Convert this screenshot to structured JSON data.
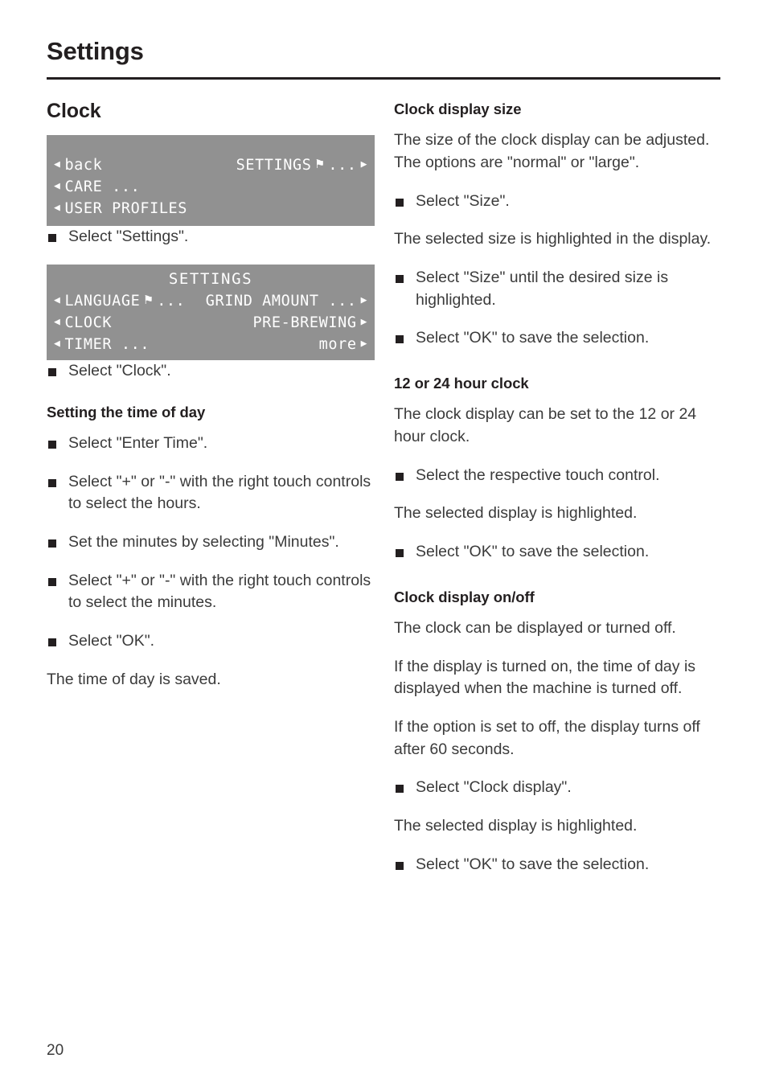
{
  "header": {
    "title": "Settings",
    "page_number": "20"
  },
  "left_column": {
    "section_title": "Clock",
    "display_1": {
      "rows": [
        {
          "left_caret": "◀",
          "left_text": "back",
          "right_text": "SETTINGS",
          "right_flag": "⚑",
          "right_ellipsis": "...",
          "right_caret": "▶"
        },
        {
          "left_caret": "◀",
          "left_text": "CARE ...",
          "right_text": "",
          "right_caret": ""
        },
        {
          "left_caret": "◀",
          "left_text": "USER PROFILES",
          "right_text": "",
          "right_caret": ""
        }
      ]
    },
    "step_after_display_1": "Select \"Settings\".",
    "display_2": {
      "title": "SETTINGS",
      "rows": [
        {
          "left_caret": "◀",
          "left_text": "LANGUAGE",
          "left_flag": "⚑",
          "left_ellipsis": "...",
          "right_text": "GRIND AMOUNT ...",
          "right_caret": "▶"
        },
        {
          "left_caret": "◀",
          "left_text": "CLOCK",
          "right_text": "PRE-BREWING",
          "right_caret": "▶"
        },
        {
          "left_caret": "◀",
          "left_text": "TIMER ...",
          "right_text": "more",
          "right_caret": "▶"
        }
      ]
    },
    "step_after_display_2": "Select \"Clock\".",
    "sub_title": "Setting the time of day",
    "steps": [
      "Select \"Enter Time\".",
      "Select \"+\" or \"-\" with the right touch controls to select the hours.",
      "Set the minutes by selecting \"Minutes\".",
      "Select \"+\" or \"-\" with the right touch controls to select the minutes.",
      "Select \"OK\"."
    ],
    "closing_para": "The time of day is saved."
  },
  "right_column": {
    "clock_display_size": {
      "sub_title": "Clock display size",
      "para_1": "The size of the clock display can be adjusted. The options are \"normal\" or \"large\".",
      "step_1": "Select \"Size\".",
      "para_2": "The selected size is highlighted in the display.",
      "step_2": "Select \"Size\" until the desired size is highlighted.",
      "step_3": "Select \"OK\" to save the selection."
    },
    "hour_clock": {
      "sub_title": "12 or 24 hour clock",
      "para_1": "The clock display can be set to the 12 or 24 hour clock.",
      "step_1": "Select the respective touch control.",
      "para_2": "The selected display is highlighted.",
      "step_2": "Select \"OK\" to save the selection."
    },
    "clock_display_onoff": {
      "sub_title": "Clock display on/off",
      "para_1": "The clock can be displayed or turned off.",
      "para_2": "If the display is turned on, the time of day is displayed when the machine is turned off.",
      "para_3": "If the option is set to off, the display turns off after 60 seconds.",
      "step_1": "Select \"Clock display\".",
      "para_4": "The selected display is highlighted.",
      "step_2": "Select \"OK\" to save the selection."
    }
  },
  "colors": {
    "lcd_background": "#919191",
    "lcd_text": "#ffffff",
    "body_text": "#3b3b3b",
    "heading_text": "#231f20"
  }
}
